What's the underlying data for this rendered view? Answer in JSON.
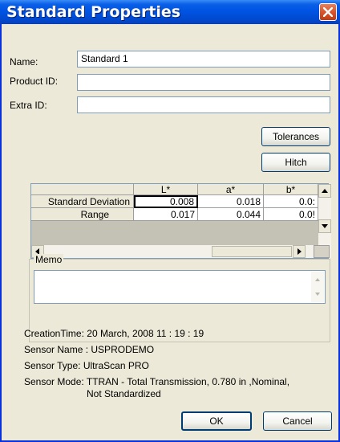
{
  "window": {
    "title": "Standard Properties"
  },
  "fields": {
    "name_label": "Name:",
    "name_value": "Standard 1",
    "product_id_label": "Product ID:",
    "product_id_value": "",
    "extra_id_label": "Extra ID:",
    "extra_id_value": ""
  },
  "buttons": {
    "tolerances": "Tolerances",
    "hitch": "Hitch",
    "ok": "OK",
    "cancel": "Cancel"
  },
  "grid": {
    "columns": [
      "L*",
      "a*",
      "b*"
    ],
    "rows": [
      {
        "label": "Standard Deviation",
        "values": [
          "0.008",
          "0.018",
          "0.0:"
        ]
      },
      {
        "label": "Range",
        "values": [
          "0.017",
          "0.044",
          "0.0!"
        ]
      }
    ]
  },
  "memo": {
    "label": "Memo",
    "value": ""
  },
  "info": {
    "creation_time_label": "CreationTime:",
    "creation_time_value": "20 March, 2008 11 : 19 : 19",
    "sensor_name_label": "Sensor Name :",
    "sensor_name_value": "USPRODEMO",
    "sensor_type_label": "Sensor Type:",
    "sensor_type_value": "UltraScan PRO",
    "sensor_mode_label": "Sensor Mode:",
    "sensor_mode_line1": "TTRAN - Total Transmission, 0.780 in ,Nominal,",
    "sensor_mode_line2": "Not Standardized"
  },
  "colors": {
    "titlebar": "#0054e3",
    "dialog_bg": "#ece9d8",
    "close_button": "#d9542a"
  }
}
